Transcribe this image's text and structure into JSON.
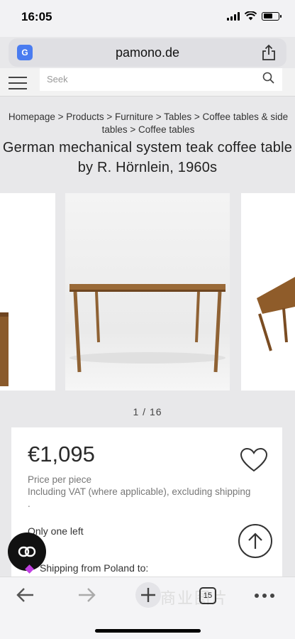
{
  "status_bar": {
    "time": "16:05"
  },
  "browser": {
    "url": "pamono.de",
    "translate_icon": "translate-icon",
    "share_icon": "share-icon"
  },
  "site": {
    "search_placeholder": "Seek"
  },
  "breadcrumb": "Homepage > Products > Furniture > Tables > Coffee tables & side tables > Coffee tables",
  "product": {
    "title": "German mechanical system teak coffee table by R. Hörnlein, 1960s",
    "image_counter": "1 / 16",
    "price": "€1,095",
    "price_note": "Price per piece",
    "vat_note": "Including VAT (where applicable), excluding shipping .",
    "stock": "Only one left",
    "shipping": "Shipping from Poland to:"
  },
  "toolbar": {
    "tab_count": "15",
    "watermark": "商业图片"
  },
  "colors": {
    "page_bg": "#e8e8ea",
    "accent_dot": "#c040e0",
    "translate_blue": "#4a7cf0"
  }
}
